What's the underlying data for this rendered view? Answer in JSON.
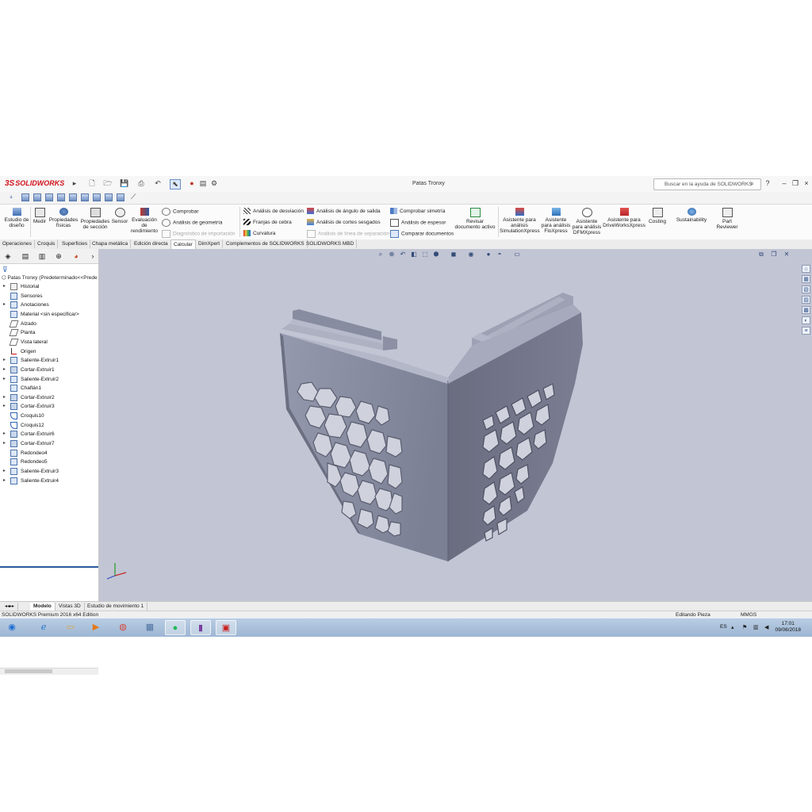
{
  "titlebar": {
    "brand": "SOLIDWORKS",
    "document_title": "Patas Tronxy",
    "search_placeholder": "Buscar en la ayuda de SOLIDWORKS",
    "help_label": "?",
    "minimize": "–",
    "restore": "❐",
    "close": "×"
  },
  "command_manager": {
    "estudio_diseno": [
      "Estudio de",
      "diseño"
    ],
    "medir": "Medir",
    "propiedades_fisicas": [
      "Propiedades",
      "físicas"
    ],
    "propiedades_seccion": [
      "Propiedades",
      "de sección"
    ],
    "sensor": "Sensor",
    "evaluacion_rendimiento": [
      "Evaluación",
      "de",
      "rendimiento"
    ],
    "comprobar": "Comprobar",
    "analisis_geometria": "Análisis de geometría",
    "diagnostico_importacion": "Diagnóstico de importación",
    "analisis_desviacion": "Análisis de desviación",
    "franjas_cebra": "Franjas de cebra",
    "curvatura": "Curvatura",
    "analisis_angulo_salida": "Análisis de ángulo de salida",
    "analisis_cortes_sesgados": "Análisis de cortes sesgados",
    "analisis_linea_separacion": "Análisis de línea de separación",
    "comprobar_simetria": "Comprobar simetría",
    "analisis_espesor": "Análisis de espesor",
    "comparar_documentos": "Comparar documentos",
    "revisar_documento": [
      "Revisar",
      "documento activo"
    ],
    "simulationxpress": [
      "Asistente para",
      "análisis",
      "SimulationXpress"
    ],
    "floxpress": [
      "Asistente",
      "para análisis",
      "FloXpress"
    ],
    "dfmxpress": [
      "Asistente",
      "para análisis",
      "DFMXpress"
    ],
    "driveworksxpress": [
      "Asistente para",
      "DriveWorksXpress"
    ],
    "costing": "Costing",
    "sustainability": "Sustainability",
    "part_reviewer": [
      "Part",
      "Reviewer"
    ]
  },
  "tabs": [
    "Operaciones",
    "Croquis",
    "Superficies",
    "Chapa metálica",
    "Edición directa",
    "Calcular",
    "DimXpert",
    "Complementos de SOLIDWORKS",
    "SOLIDWORKS MBD"
  ],
  "active_tab": "Calcular",
  "feature_tree": {
    "root": "Patas Tronxy  (Predeterminado<<Prede",
    "items": [
      {
        "label": "Historial",
        "icon": "history-icon",
        "expand": true
      },
      {
        "label": "Sensores",
        "icon": "sensor-icon",
        "expand": false
      },
      {
        "label": "Anotaciones",
        "icon": "annotations-icon",
        "expand": true
      },
      {
        "label": "Material <sin especificar>",
        "icon": "material-icon",
        "expand": false
      },
      {
        "label": "Alzado",
        "icon": "plane-icon",
        "expand": false
      },
      {
        "label": "Planta",
        "icon": "plane-icon",
        "expand": false
      },
      {
        "label": "Vista lateral",
        "icon": "plane-icon",
        "expand": false
      },
      {
        "label": "Origen",
        "icon": "origin-icon",
        "expand": false
      },
      {
        "label": "Saliente-Extruir1",
        "icon": "extrude-boss-icon",
        "expand": true
      },
      {
        "label": "Cortar-Extruir1",
        "icon": "extrude-cut-icon",
        "expand": true
      },
      {
        "label": "Saliente-Extruir2",
        "icon": "extrude-boss-icon",
        "expand": true
      },
      {
        "label": "Chaflán1",
        "icon": "chamfer-icon",
        "expand": false
      },
      {
        "label": "Cortar-Extruir2",
        "icon": "extrude-cut-icon",
        "expand": true
      },
      {
        "label": "Cortar-Extruir3",
        "icon": "extrude-cut-icon",
        "expand": true
      },
      {
        "label": "Croquis10",
        "icon": "sketch-icon",
        "expand": false
      },
      {
        "label": "Croquis12",
        "icon": "sketch-icon",
        "expand": false
      },
      {
        "label": "Cortar-Extruir6",
        "icon": "extrude-cut-icon",
        "expand": true
      },
      {
        "label": "Cortar-Extruir7",
        "icon": "extrude-cut-icon",
        "expand": true
      },
      {
        "label": "Redondeo4",
        "icon": "fillet-icon",
        "expand": false
      },
      {
        "label": "Redondeo5",
        "icon": "fillet-icon",
        "expand": false
      },
      {
        "label": "Saliente-Extruir3",
        "icon": "extrude-boss-icon",
        "expand": true
      },
      {
        "label": "Saliente-Extruir4",
        "icon": "extrude-boss-icon",
        "expand": true
      }
    ]
  },
  "model_tabs": [
    "Modelo",
    "Vistas 3D",
    "Estudio de movimiento 1"
  ],
  "status_bar": {
    "edition": "SOLIDWORKS Premium 2016 x64 Edition",
    "mode": "Editando Pieza",
    "units": "MMGS"
  },
  "taskbar": {
    "language": "ES",
    "time": "17:01",
    "date": "09/06/2018"
  },
  "colors": {
    "viewport_bg": "#c2c5d4",
    "part_face_light": "#9a9eb2",
    "part_face_dark": "#6e7184",
    "accent": "#d0121b"
  }
}
